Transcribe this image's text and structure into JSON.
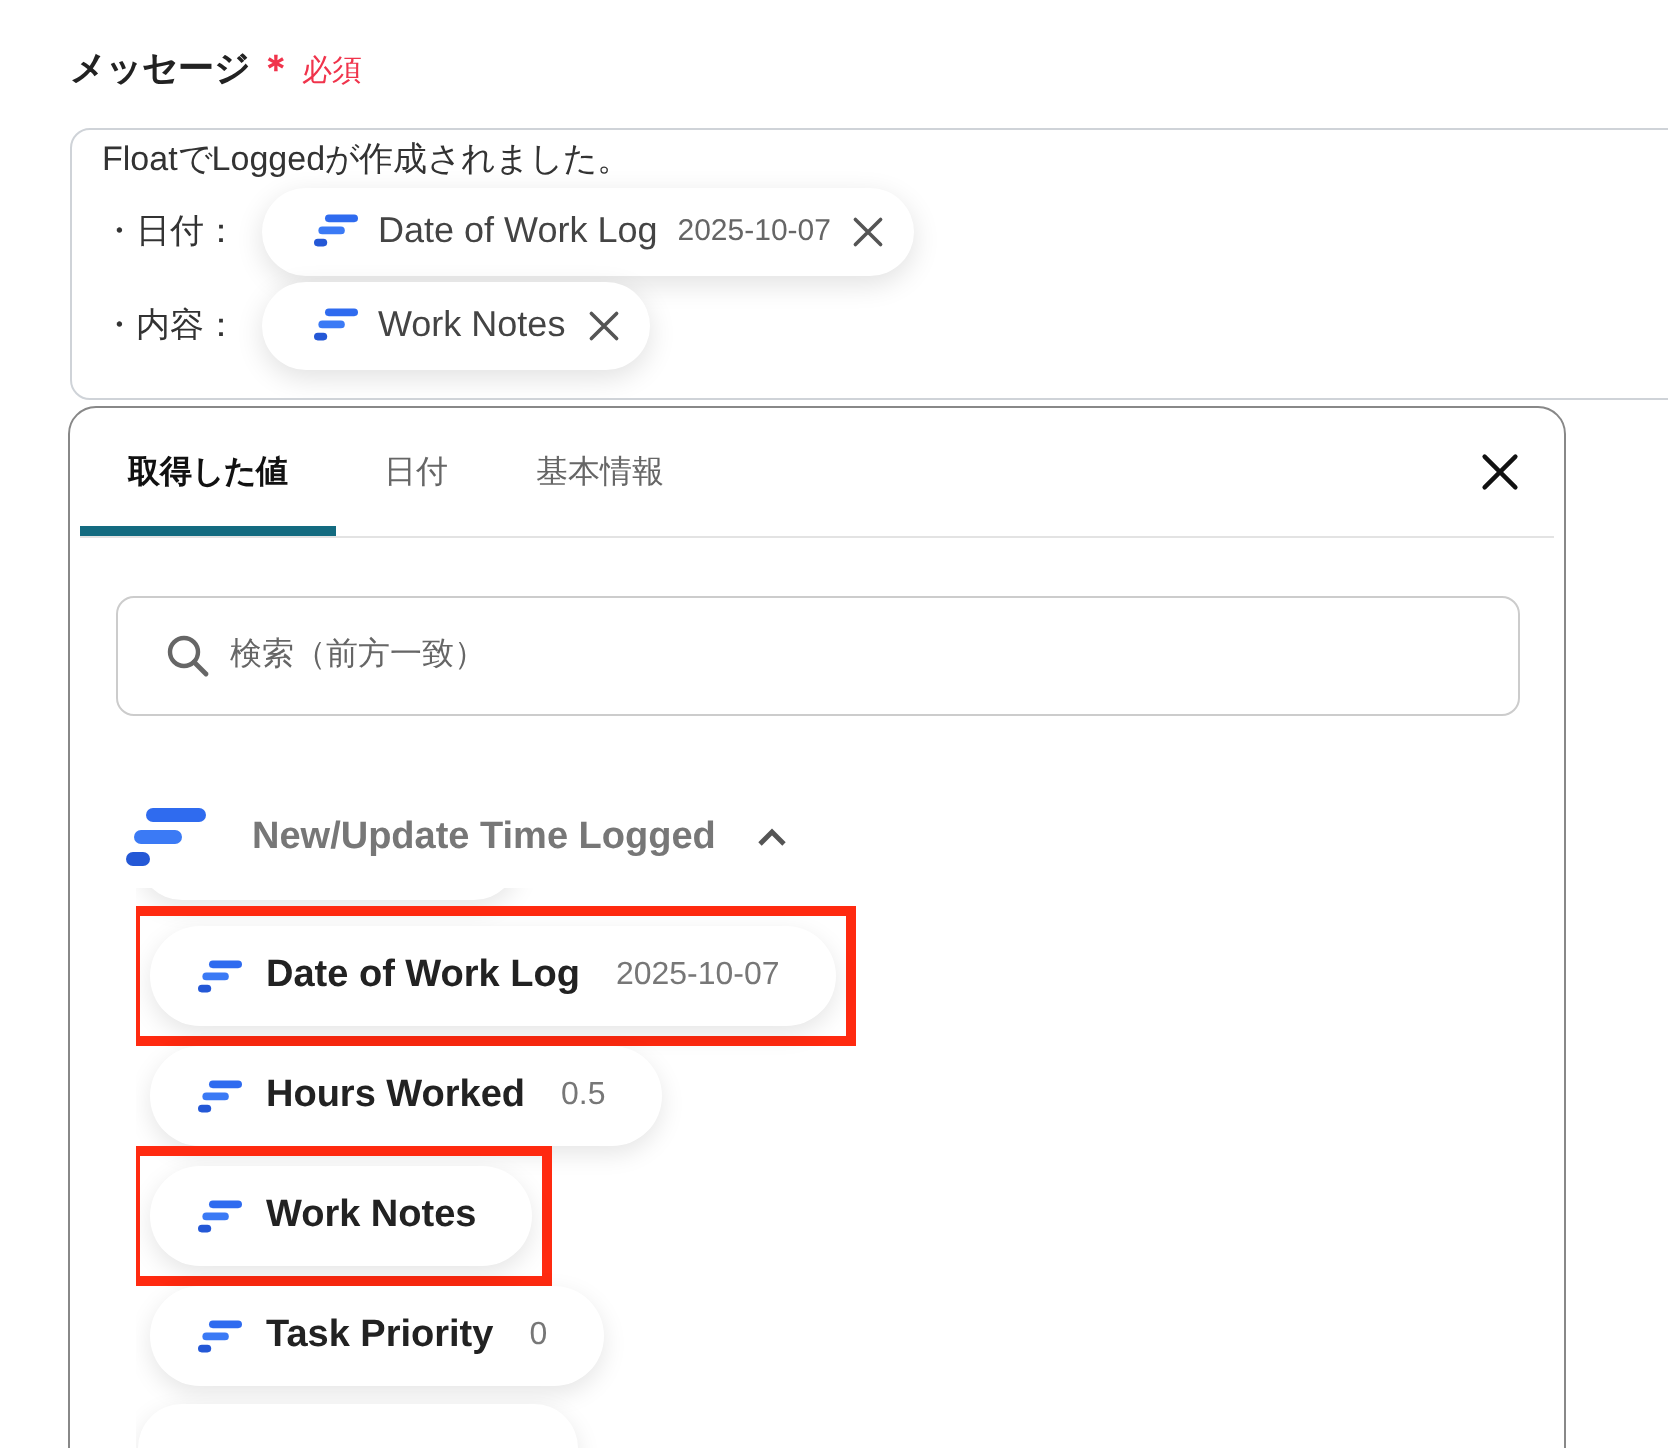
{
  "field": {
    "label": "メッセージ",
    "required_mark": "＊",
    "required_text": "必須",
    "intro": "FloatでLoggedが作成されました。",
    "lines": [
      {
        "prefix": "・日付：",
        "chip": {
          "name": "Date of Work Log",
          "value": "2025-10-07"
        }
      },
      {
        "prefix": "・内容：",
        "chip": {
          "name": "Work Notes"
        }
      }
    ]
  },
  "picker": {
    "tabs": [
      {
        "label": "取得した値",
        "selected": true
      },
      {
        "label": "日付",
        "selected": false
      },
      {
        "label": "基本情報",
        "selected": false
      }
    ],
    "search": {
      "placeholder": "検索（前方一致）"
    },
    "group": {
      "title": "New/Update Time Logged",
      "expanded": true
    },
    "items": [
      {
        "kind": "cut"
      },
      {
        "kind": "value",
        "name": "Date of Work Log",
        "value": "2025-10-07",
        "highlighted": true
      },
      {
        "kind": "value",
        "name": "Hours Worked",
        "value": "0.5",
        "highlighted": false
      },
      {
        "kind": "value",
        "name": "Work Notes",
        "highlighted": true
      },
      {
        "kind": "value",
        "name": "Task Priority",
        "value": "0",
        "highlighted": false
      },
      {
        "kind": "cut"
      }
    ]
  }
}
